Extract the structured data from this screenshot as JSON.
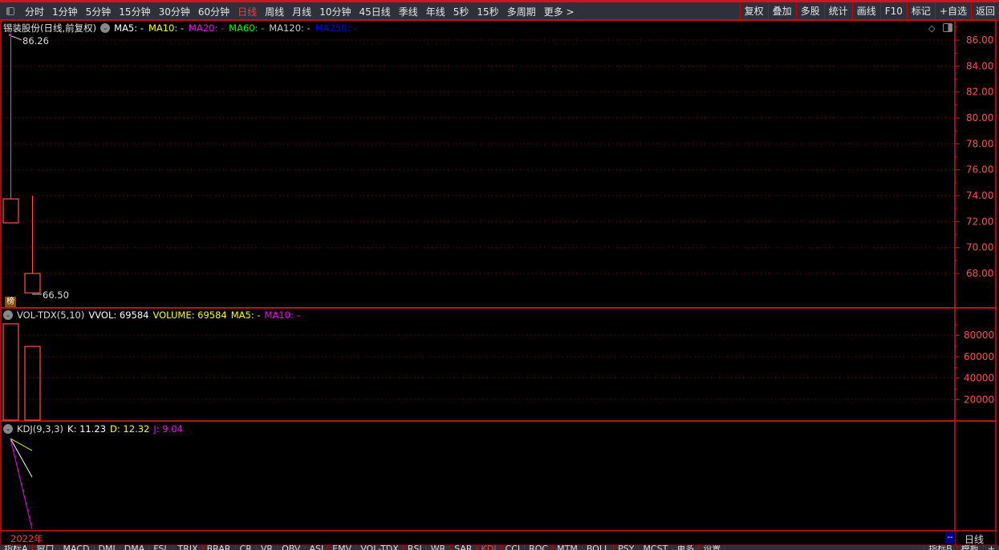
{
  "toolbar": {
    "periods": [
      "分时",
      "1分钟",
      "5分钟",
      "15分钟",
      "30分钟",
      "60分钟",
      "日线",
      "周线",
      "月线",
      "10分钟",
      "45日线",
      "季线",
      "年线",
      "5秒",
      "15秒",
      "多周期",
      "更多 >"
    ],
    "active": "日线",
    "right": [
      "复权",
      "叠加",
      "多股",
      "统计",
      "画线",
      "F10",
      "标记",
      "+自选",
      "返回"
    ]
  },
  "main": {
    "title": "锡装股份(日线,前复权)",
    "ma": [
      {
        "label": "MA5: -",
        "color": "#ffffff"
      },
      {
        "label": "MA10: -",
        "color": "#ffff00"
      },
      {
        "label": "MA20: -",
        "color": "#ff00ff"
      },
      {
        "label": "MA60: -",
        "color": "#00ff00"
      },
      {
        "label": "MA120: -",
        "color": "#cccccc"
      },
      {
        "label": "MA250: -",
        "color": "#0000ff"
      }
    ],
    "high_label": "86.26",
    "low_label": "66.50",
    "badge": "榜"
  },
  "volume": {
    "title": "VOL-TDX(5,10)",
    "vvol": "VVOL: 69584",
    "volume": "VOLUME: 69584",
    "ma5": "MA5: -",
    "ma10": "MA10: -"
  },
  "kdj": {
    "title": "KDJ(9,3,3)",
    "k": "K: 11.23",
    "d": "D: 12.32",
    "j": "J: 9.04"
  },
  "date_row": {
    "year": "2022年",
    "period": "日线",
    "marker": "--"
  },
  "bottom_tabs": [
    "指标A",
    "窗口",
    "MACD",
    "DMI",
    "DMA",
    "FSL",
    "TRIX",
    "BRAR",
    "CR",
    "VR",
    "OBV",
    "ASI",
    "EMV",
    "VOL-TDX",
    "RSI",
    "WR",
    "SAR",
    "KDJ",
    "CCI",
    "ROC",
    "MTM",
    "BOLL",
    "PSY",
    "MCST",
    "更多",
    "设置"
  ],
  "bottom_right": [
    "指标B",
    "模板",
    "+"
  ],
  "colors": {
    "up": "#ff5050",
    "axis": "#d0141c",
    "grid": "#8b0000"
  },
  "chart_data": [
    {
      "type": "candlestick",
      "title": "锡装股份(日线,前复权)",
      "ylim": [
        66,
        87
      ],
      "yticks": [
        68,
        70,
        72,
        74,
        76,
        78,
        80,
        82,
        84,
        86
      ],
      "candles": [
        {
          "open": 71.9,
          "close": 73.75,
          "high": 86.26,
          "low": 71.9
        },
        {
          "open": 66.5,
          "close": 68.0,
          "high": 74.0,
          "low": 66.5
        }
      ]
    },
    {
      "type": "bar",
      "title": "VOL-TDX(5,10)",
      "ylim": [
        0,
        90000
      ],
      "yticks": [
        20000,
        40000,
        60000,
        80000
      ],
      "values": [
        90700,
        69584
      ]
    },
    {
      "type": "line",
      "title": "KDJ(9,3,3)",
      "series": [
        {
          "name": "K",
          "color": "#ffffff",
          "values": [
            100,
            11.23
          ]
        },
        {
          "name": "D",
          "color": "#ffff00",
          "values": [
            100,
            12.32
          ]
        },
        {
          "name": "J",
          "color": "#ff00ff",
          "values": [
            100,
            9.04
          ]
        }
      ]
    }
  ]
}
